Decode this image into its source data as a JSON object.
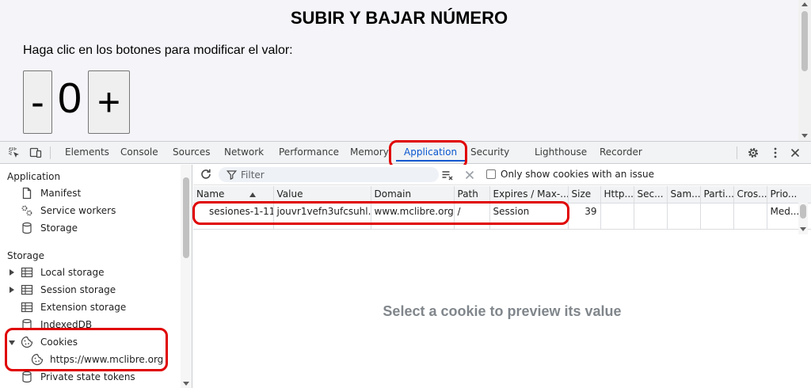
{
  "page": {
    "title": "SUBIR Y BAJAR NÚMERO",
    "instruction": "Haga clic en los botones para modificar el valor:",
    "minus_label": "-",
    "value": "0",
    "plus_label": "+"
  },
  "devtools": {
    "tabs": [
      {
        "label": "Elements"
      },
      {
        "label": "Console"
      },
      {
        "label": "Sources"
      },
      {
        "label": "Network"
      },
      {
        "label": "Performance"
      },
      {
        "label": "Memory"
      },
      {
        "label": "Application",
        "active": true
      },
      {
        "label": "Security"
      },
      {
        "label": "Lighthouse"
      },
      {
        "label": "Recorder"
      }
    ],
    "accent_color": "#0b57d0",
    "highlight_color": "#e00000",
    "sidebar": {
      "application_header": "Application",
      "application_items": [
        "Manifest",
        "Service workers",
        "Storage"
      ],
      "storage_header": "Storage",
      "storage_items": [
        "Local storage",
        "Session storage",
        "Extension storage",
        "IndexedDB",
        "Cookies"
      ],
      "cookie_origin": "https://www.mclibre.org",
      "after_items": [
        "Private state tokens"
      ]
    },
    "cookies": {
      "filter_placeholder": "Filter",
      "only_issue_label": "Only show cookies with an issue",
      "columns": [
        "Name",
        "Value",
        "Domain",
        "Path",
        "Expires / Max-...",
        "Size",
        "Http...",
        "Sec...",
        "Sam...",
        "Parti...",
        "Cros...",
        "Prio..."
      ],
      "rows": [
        [
          "sesiones-1-11",
          "jouvr1vefn3ufcsuhl...",
          "www.mclibre.org",
          "/",
          "Session",
          "39",
          "",
          "",
          "",
          "",
          "",
          "Med..."
        ]
      ],
      "preview_message": "Select a cookie to preview its value"
    }
  }
}
